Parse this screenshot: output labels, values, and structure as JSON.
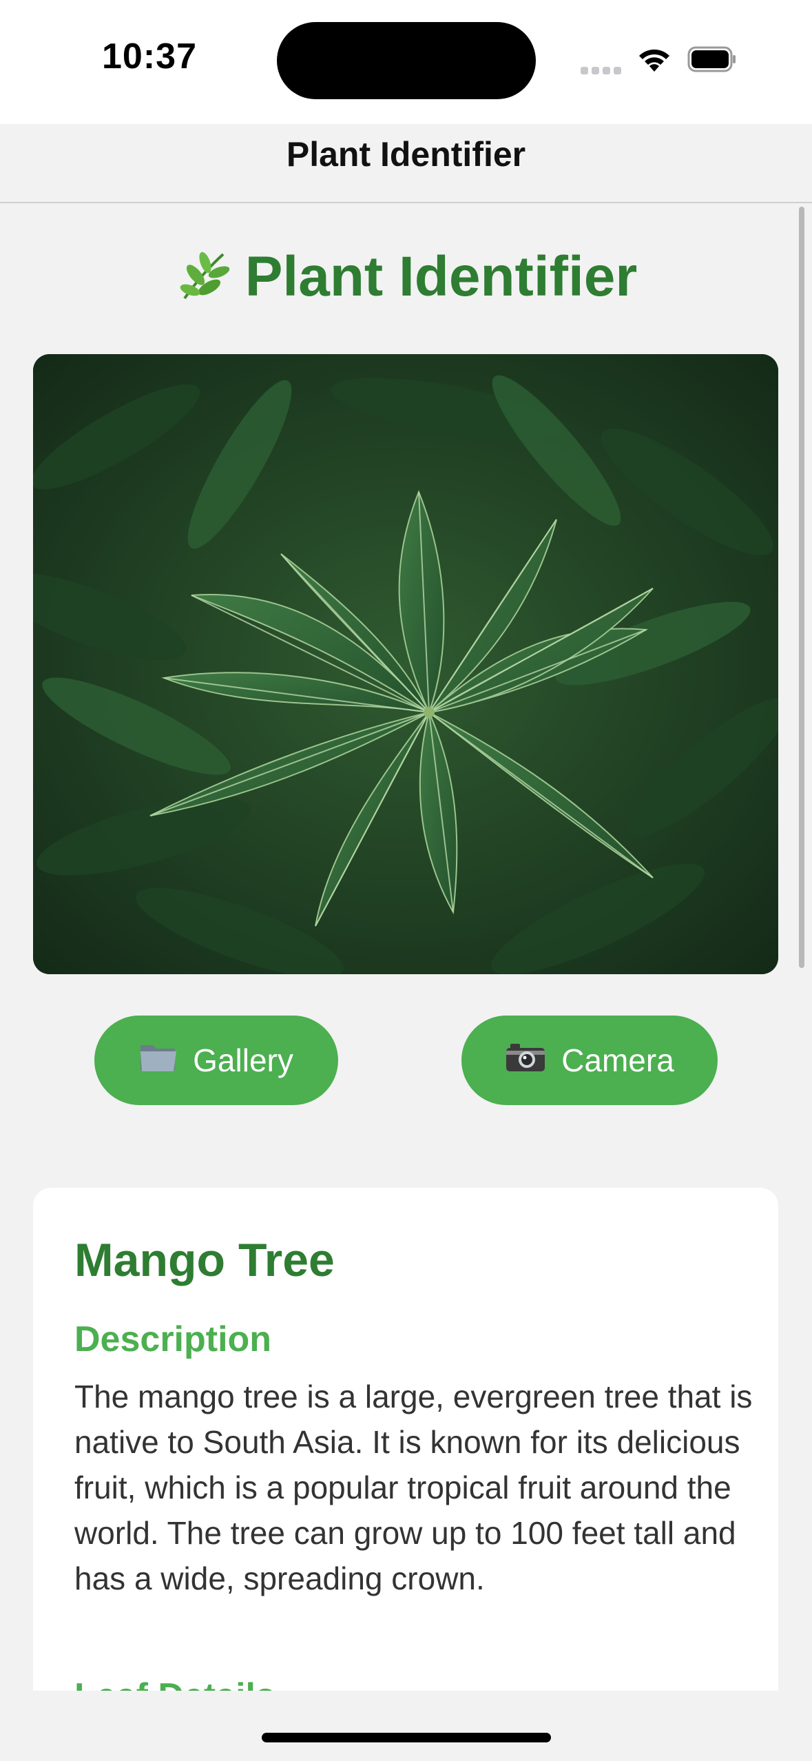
{
  "status": {
    "time": "10:37"
  },
  "nav": {
    "title": "Plant Identifier"
  },
  "header": {
    "title": "Plant Identifier"
  },
  "photo": {
    "alt": "Green mango tree leaves"
  },
  "buttons": {
    "gallery": "Gallery",
    "camera": "Camera"
  },
  "result": {
    "name": "Mango Tree",
    "description_title": "Description",
    "description": "The mango tree is a large, evergreen tree that is native to South Asia. It is known for its delicious fruit, which is a popular tropical fruit around the world. The tree can grow up to 100 feet tall and has a wide, spreading crown.",
    "leaf_details_title": "Leaf Details"
  },
  "icons": {
    "leaf": "herb-icon",
    "gallery": "folder-icon",
    "camera": "camera-icon"
  },
  "colors": {
    "title_green": "#2e7d32",
    "button_green": "#4caf50",
    "background": "#f2f2f2"
  }
}
